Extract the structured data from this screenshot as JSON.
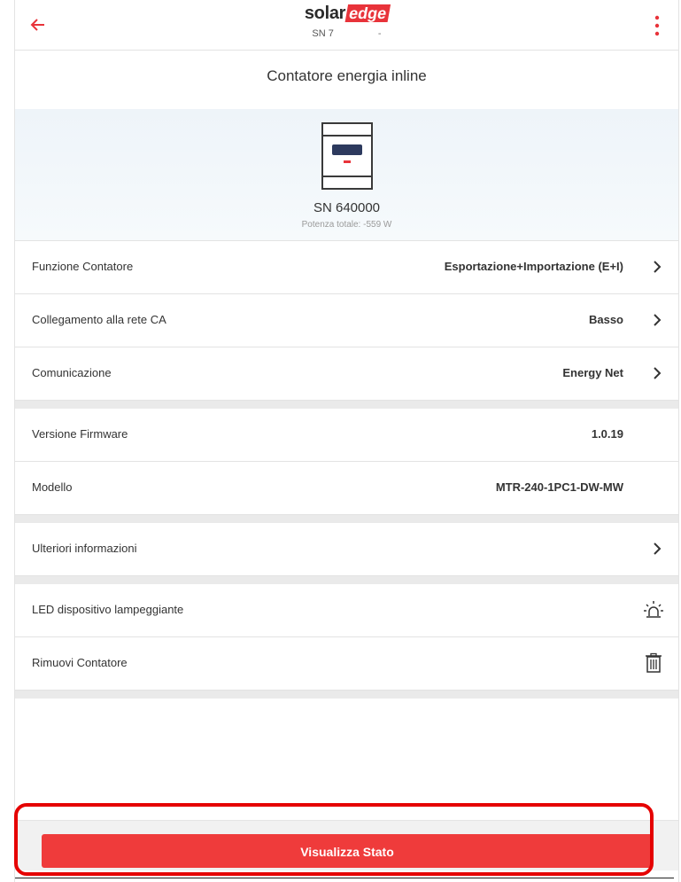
{
  "header": {
    "logo_solar": "solar",
    "logo_edge": "edge",
    "sn_label": "SN 7",
    "sn_dash": "-"
  },
  "page": {
    "title": "Contatore energia inline"
  },
  "device": {
    "sn": "SN 640000",
    "power": "Potenza totale: -559 W"
  },
  "rows": [
    {
      "label": "Funzione Contatore",
      "value": "Esportazione+Importazione (E+I)"
    },
    {
      "label": "Collegamento alla rete CA",
      "value": "Basso"
    },
    {
      "label": "Comunicazione",
      "value": "Energy Net"
    },
    {
      "label": "Versione Firmware",
      "value": "1.0.19"
    },
    {
      "label": "Modello",
      "value": "MTR-240-1PC1-DW-MW"
    },
    {
      "label": "Ulteriori informazioni"
    },
    {
      "label": "LED dispositivo lampeggiante"
    },
    {
      "label": "Rimuovi Contatore"
    }
  ],
  "action": {
    "label": "Visualizza Stato"
  },
  "icons": {
    "back": "arrow-left-icon",
    "menu": "kebab-menu-icon",
    "chevron": "chevron-right-icon",
    "blink": "siren-led-icon",
    "trash": "trash-icon",
    "meter": "meter-device-icon"
  },
  "colors": {
    "accent": "#ef3b3b",
    "highlight": "#e50000",
    "brand_edge": "#e8333a"
  }
}
